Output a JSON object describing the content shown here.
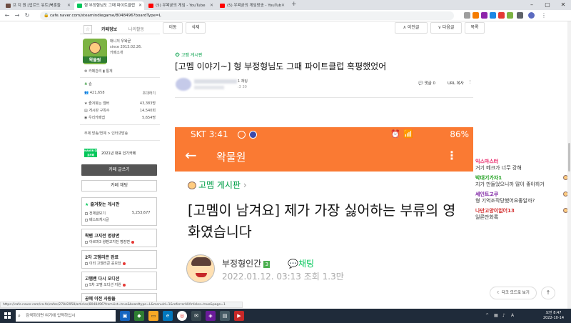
{
  "browser": {
    "tabs": [
      {
        "label": "프 지 원 [업르드 유트]북훈들",
        "color": "#6d4c41"
      },
      {
        "label": "형 부정형님도 그때 파이트클럽",
        "color": "#03c75a"
      },
      {
        "label": "(5) 우왁굳의 게임 - YouTube",
        "color": "#ff0000"
      },
      {
        "label": "(5) 우왁굳의 게임방송 - YouTub",
        "color": "#ff0000"
      }
    ],
    "new_tab": "+",
    "url": "cafe.naver.com/steamindiegame/8048496?boardType=L"
  },
  "cafe": {
    "tab_info": "카페정보",
    "tab_activity": "나의활동",
    "logo_text": "왁물원",
    "manager_label": "매니저",
    "manager_name": "우왁굳",
    "since": "since 2013.02.26.",
    "cafe_intro": "카페소개",
    "cafe_manage": "카페관리",
    "stats": "통계",
    "level": "숲",
    "members": "421,658",
    "invite": "초대하기",
    "rows": [
      {
        "label": "즐겨찾는 멤버",
        "value": "43,383명"
      },
      {
        "label": "게시판 구독수",
        "value": "14,540회"
      },
      {
        "label": "우리카페앱",
        "value": "5,654명"
      }
    ],
    "tags": "주제  방송/연예 > 인터넷방송",
    "naver_badge": "NAVER 대표카페",
    "badge_text": "2021년 대표 인기카페",
    "write_button": "카페 글쓰기",
    "chat_button": "카페 채팅",
    "fav_board_head": "즐겨찾는 게시판",
    "fav_items": [
      {
        "label": "전체글보기",
        "value": "5,253,677"
      },
      {
        "label": "베스트게시글",
        "value": ""
      }
    ],
    "box2_head": "왁팬 고지전 명장면",
    "box2_item": "아르마3 왕팬고지전 명장면",
    "box3_head": "2차 고멤리콘 완료",
    "box3_item": "이리 고멤리콘 공모전",
    "box4_head": "고멤밴 다시 오디션",
    "box4_item": "5차 고멤 오디션 지원",
    "box5_head": "공예 이전 사람들"
  },
  "toolbar": {
    "move": "이동",
    "delete": "삭제",
    "prev": "∧ 이전글",
    "next": "∨ 다음글",
    "list": "목록"
  },
  "article": {
    "board": "고멤 게시판",
    "title": "[고멤 이야기~] 형 부정형님도 그때 파이트클럽 혹평했었어",
    "author_suffix": "1 채팅",
    "date_suffix": ":3 30",
    "comment": "댓글 0",
    "url_copy": "URL 복사"
  },
  "phone": {
    "time": "SKT 3:41",
    "battery": "86%",
    "app_title": "왁물원",
    "board": "고멤 게시판",
    "title": "[고멤이 남겨요] 제가 가장 싫어하는 부류의 영화였습니다",
    "author": "부정형인간",
    "level": "3",
    "chat": "채팅",
    "date": "2022.01.12. 03:13 조회 1.3만"
  },
  "chat_overlay": [
    {
      "who": "익스마스터",
      "msg": "거기 메크가 너무 강해",
      "color": "#e91e63"
    },
    {
      "who": "박대기가자1",
      "msg": "지가 만들었으니까 많이 좋아하거",
      "color": "#1b9e1b"
    },
    {
      "who": "세인트고쿠",
      "msg": "형 기억조작당했어요좋알까?",
      "color": "#7b1fa2"
    },
    {
      "who": "나만고양이없어13",
      "msg": "일론만화록",
      "color": "#d32f2f"
    }
  ],
  "floating": {
    "darkmode": "다크 모드로 보기",
    "top": "↑"
  },
  "status_url": "https://cafe.naver.com/ca-fe/cafes/27842958/articles/8048496?fromList=true&boardtype=L&menuId=1&referrerAllArticles=true&page=1",
  "taskbar": {
    "search": "검색하려면 여기에 입력하십시",
    "time": "오전 8:47",
    "date": "2022-10-14"
  }
}
